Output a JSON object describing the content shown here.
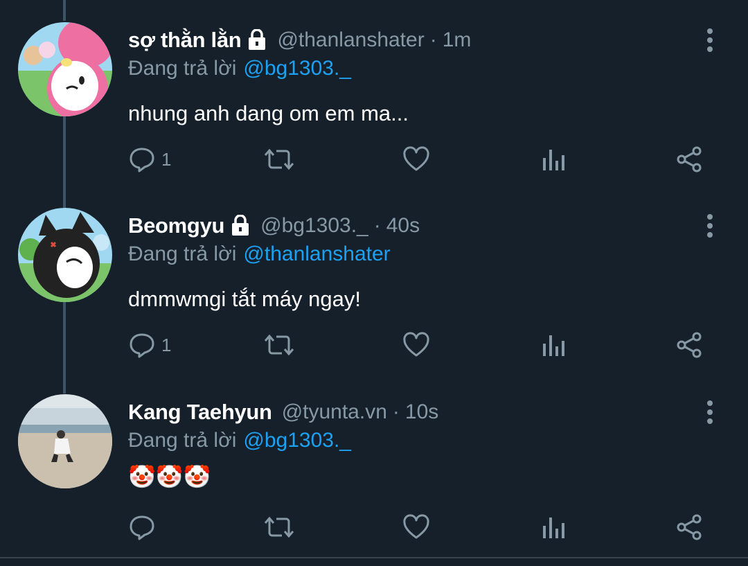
{
  "colors": {
    "background": "#15202b",
    "secondary_text": "#8899a6",
    "mention": "#1da1f2",
    "icon": "#8899a6"
  },
  "tweets": [
    {
      "display_name": "sợ thằn lằn",
      "protected": true,
      "handle": "@thanlanshater",
      "separator": "·",
      "time": "1m",
      "reply_prefix": "Đang trả lời",
      "reply_to": "@bg1303._",
      "text": "nhung anh dang om em ma...",
      "reply_count": "1"
    },
    {
      "display_name": "Beomgyu",
      "protected": true,
      "handle": "@bg1303._",
      "separator": "·",
      "time": "40s",
      "reply_prefix": "Đang trả lời",
      "reply_to": "@thanlanshater",
      "text": "dmmwmgi tắt máy ngay!",
      "reply_count": "1"
    },
    {
      "display_name": "Kang Taehyun",
      "protected": false,
      "handle": "@tyunta.vn",
      "separator": "·",
      "time": "10s",
      "reply_prefix": "Đang trả lời",
      "reply_to": "@bg1303._",
      "text": "🤡🤡🤡",
      "reply_count": ""
    }
  ],
  "icons": {
    "reply": "reply-bubble-icon",
    "retweet": "retweet-icon",
    "like": "heart-icon",
    "analytics": "analytics-bars-icon",
    "share": "share-icon",
    "more": "more-vertical-icon",
    "lock": "lock-icon"
  }
}
